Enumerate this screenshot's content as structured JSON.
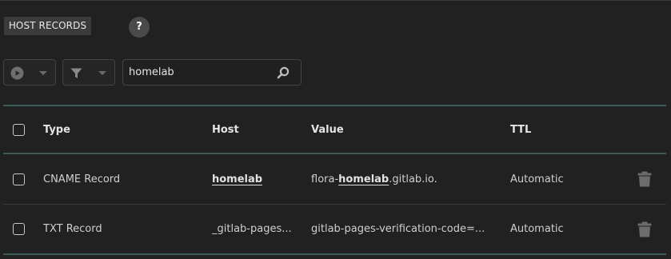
{
  "header": {
    "section_tab": "HOST RECORDS",
    "help_label": "?"
  },
  "toolbar": {
    "actions_icon": "play-circle-icon",
    "filter_icon": "filter-icon",
    "search_value": "homelab",
    "search_icon": "magnifier-icon"
  },
  "table": {
    "columns": [
      "Type",
      "Host",
      "Value",
      "TTL"
    ],
    "rows": [
      {
        "type": "CNAME Record",
        "host": "homelab",
        "value_prefix": "flora-",
        "value_highlight": "homelab",
        "value_suffix": ".gitlab.io.",
        "ttl": "Automatic"
      },
      {
        "type": "TXT Record",
        "host": "_gitlab-pages...",
        "value": "gitlab-pages-verification-code=...",
        "ttl": "Automatic"
      }
    ]
  },
  "colors": {
    "background": "#212121",
    "accent_divider": "#3c5c5a",
    "tab_bg": "#3b3b3b"
  }
}
